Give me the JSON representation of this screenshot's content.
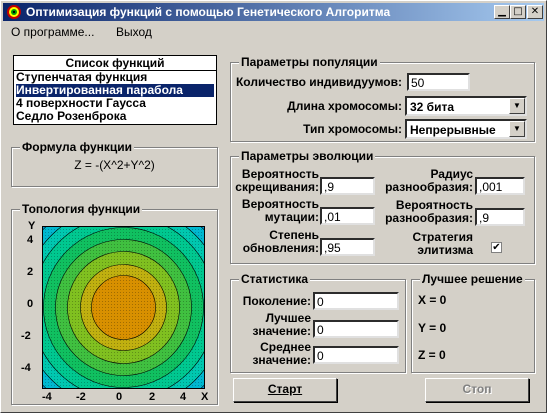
{
  "window": {
    "title": "Оптимизация функций с помощью Генетического Алгоритма"
  },
  "menu": {
    "about": "О программе...",
    "exit": "Выход"
  },
  "functions": {
    "header": "Список функций",
    "items": [
      "Ступенчатая функция",
      "Инвертированная парабола",
      "4 поверхности Гаусса",
      "Седло Розенброка"
    ],
    "selected_index": 1
  },
  "formula": {
    "legend": "Формула функции",
    "text": "Z = -(X^2+Y^2)"
  },
  "topology": {
    "legend": "Топология функции",
    "y_axis_label": "Y",
    "x_axis_label": "X",
    "y_ticks": [
      "4",
      "2",
      "0",
      "-2",
      "-4"
    ],
    "x_ticks": [
      "-4",
      "-2",
      "0",
      "2",
      "4"
    ]
  },
  "population": {
    "legend": "Параметры популяции",
    "count_label": "Количество индивидуумов:",
    "count_value": "50",
    "length_label": "Длина хромосомы:",
    "length_value": "32 бита",
    "type_label": "Тип хромосомы:",
    "type_value": "Непрерывные"
  },
  "evolution": {
    "legend": "Параметры эволюции",
    "crossover_label_1": "Вероятность",
    "crossover_label_2": "скрещивания:",
    "crossover_value": ",9",
    "mutation_label_1": "Вероятность",
    "mutation_label_2": "мутации:",
    "mutation_value": ",01",
    "update_label_1": "Степень",
    "update_label_2": "обновления:",
    "update_value": ",95",
    "radius_label_1": "Радиус",
    "radius_label_2": "разнообразия:",
    "radius_value": ",001",
    "diversity_label_1": "Вероятность",
    "diversity_label_2": "разнообразия:",
    "diversity_value": ",9",
    "elitism_label_1": "Стратегия",
    "elitism_label_2": "элитизма",
    "elitism_checked": true
  },
  "stats": {
    "legend": "Статистика",
    "gen_label": "Поколение:",
    "gen_value": "0",
    "best_label_1": "Лучшее",
    "best_label_2": "значение:",
    "best_value": "0",
    "avg_label_1": "Среднее",
    "avg_label_2": "значение:",
    "avg_value": "0"
  },
  "best": {
    "legend": "Лучшее решение",
    "x": "X = 0",
    "y": "Y = 0",
    "z": "Z = 0"
  },
  "buttons": {
    "start": "Старт",
    "stop": "Стоп"
  },
  "colors": {
    "title_start": "#0a246a",
    "title_end": "#a6caf0",
    "selection": "#0a246a",
    "plot_outer": "#00a0e0",
    "plot_center": "#d08000"
  }
}
